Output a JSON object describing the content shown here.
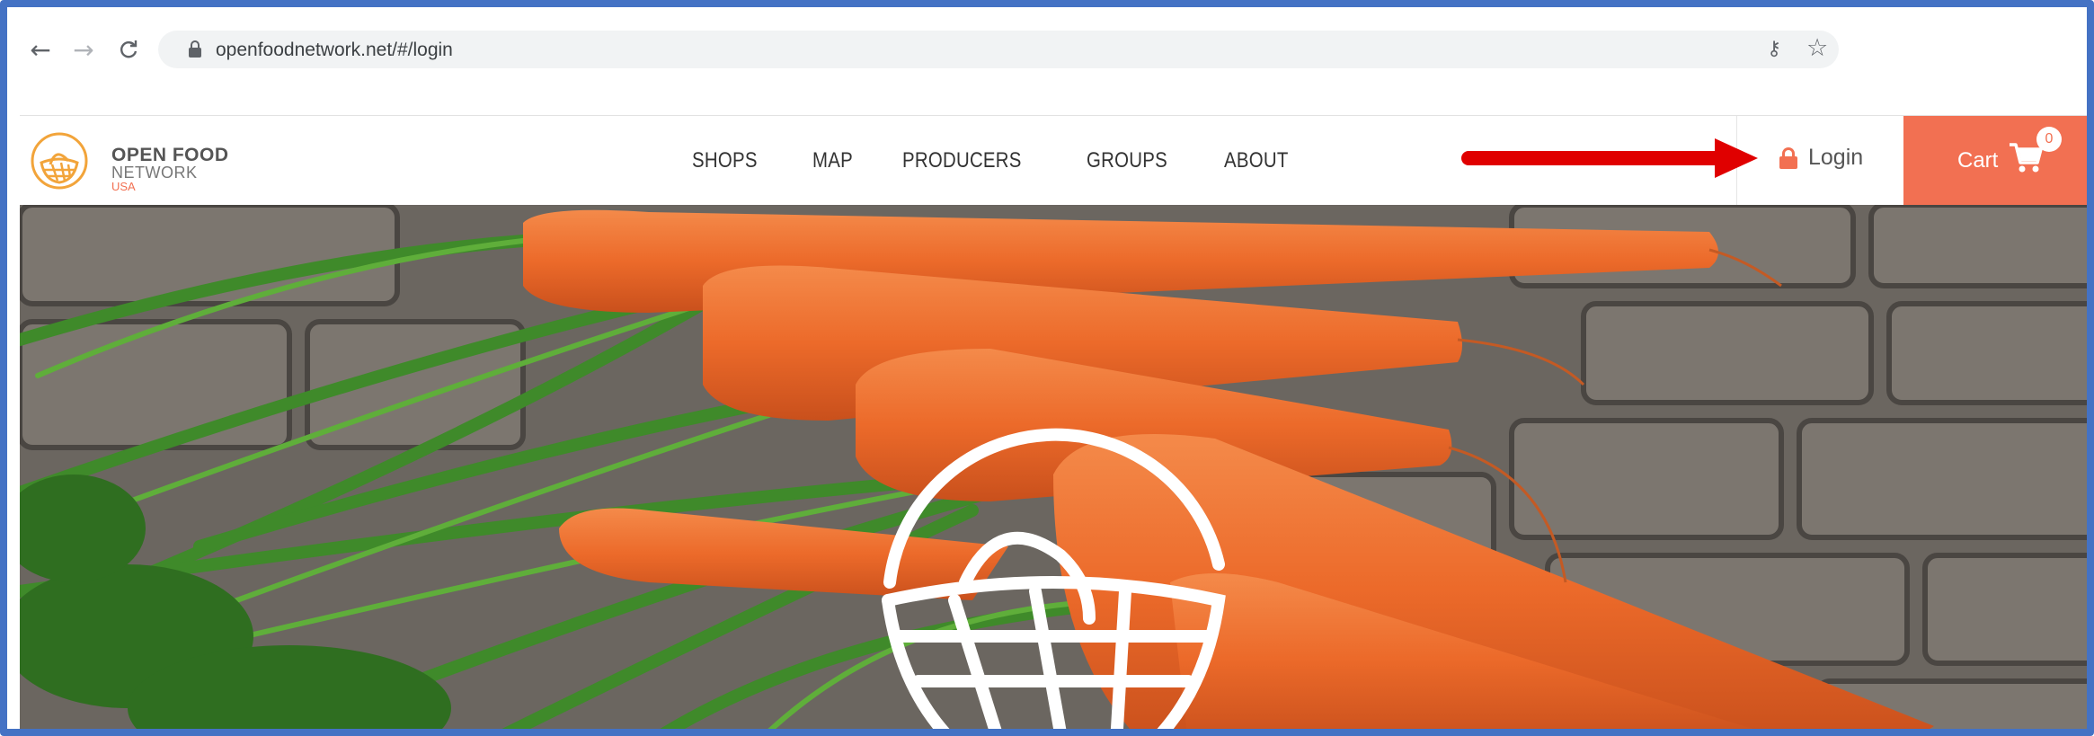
{
  "browser": {
    "url": "openfoodnetwork.net/#/login",
    "back_icon": "←",
    "forward_icon": "→",
    "reload_icon": "C",
    "key_icon": "⚷",
    "star_icon": "☆"
  },
  "site": {
    "logo": {
      "line1": "OPEN FOOD",
      "line2": "NETWORK",
      "line3": "USA"
    },
    "nav": [
      "SHOPS",
      "MAP",
      "PRODUCERS",
      "GROUPS",
      "ABOUT"
    ],
    "login_label": "Login",
    "cart_label": "Cart",
    "cart_count": "0"
  },
  "colors": {
    "accent": "#f27052",
    "frame": "#4472c4",
    "annotation": "#e00000"
  }
}
